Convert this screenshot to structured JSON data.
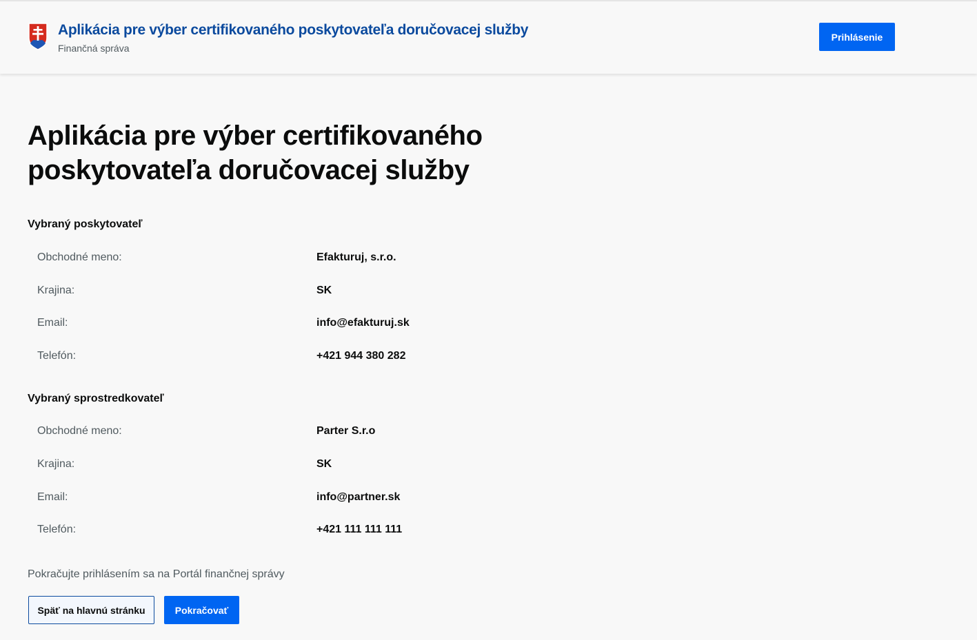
{
  "header": {
    "app_title": "Aplikácia pre výber certifikovaného poskytovateľa doručovacej služby",
    "app_subtitle": "Finančná správa",
    "login_label": "Prihlásenie"
  },
  "colors": {
    "brand_blue": "#0b4a9e",
    "primary_button": "#0065f2",
    "muted_text": "#505a5f",
    "coat_red": "#d52b1e",
    "coat_blue": "#1e56b4"
  },
  "page_title": "Aplikácia pre výber certifikovaného poskytovateľa doručovacej služby",
  "provider": {
    "heading": "Vybraný poskytovateľ",
    "rows": [
      {
        "label": "Obchodné meno:",
        "value": "Efakturuj, s.r.o."
      },
      {
        "label": "Krajina:",
        "value": "SK"
      },
      {
        "label": "Email:",
        "value": "info@efakturuj.sk"
      },
      {
        "label": "Telefón:",
        "value": "+421 944 380 282"
      }
    ]
  },
  "intermediary": {
    "heading": "Vybraný sprostredkovateľ",
    "rows": [
      {
        "label": "Obchodné meno:",
        "value": "Parter S.r.o"
      },
      {
        "label": "Krajina:",
        "value": "SK"
      },
      {
        "label": "Email:",
        "value": "info@partner.sk"
      },
      {
        "label": "Telefón:",
        "value": "+421 111 111 111"
      }
    ]
  },
  "hint": "Pokračujte prihlásením sa na Portál finančnej správy",
  "buttons": {
    "back_label": "Späť na hlavnú stránku",
    "continue_label": "Pokračovať"
  }
}
